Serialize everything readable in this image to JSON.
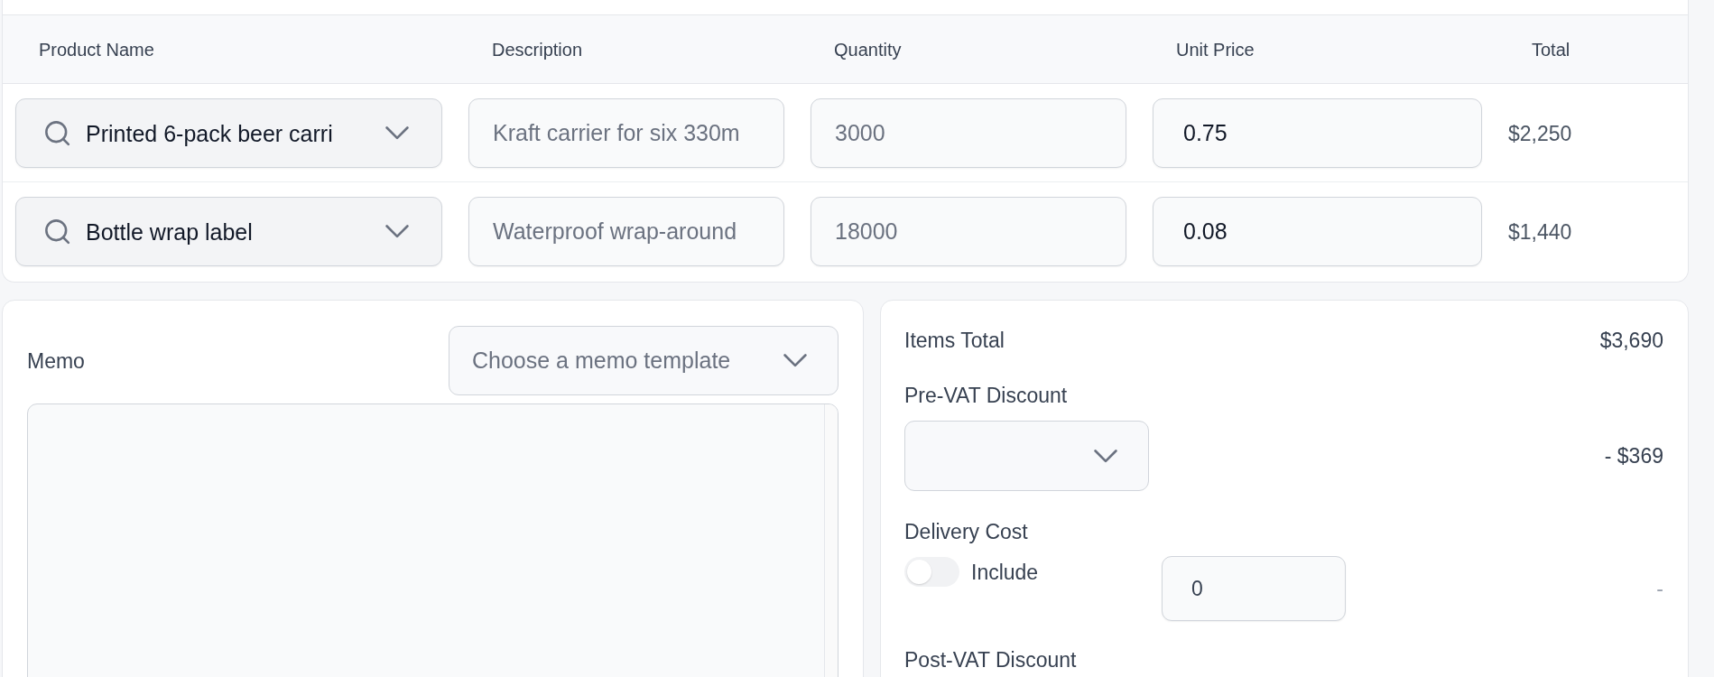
{
  "table": {
    "columns": [
      "Product Name",
      "Description",
      "Quantity",
      "Unit Price",
      "Total"
    ],
    "rows": [
      {
        "product": "Printed 6-pack beer carri",
        "description": {
          "value": "Kraft carrier for six 330m",
          "disabled": true
        },
        "quantity": {
          "value": "3000",
          "disabled": true
        },
        "unit_price": {
          "value": "0.75",
          "disabled": false
        },
        "total": "$2,250"
      },
      {
        "product": "Bottle wrap label",
        "description": {
          "value": "Waterproof wrap-around",
          "disabled": true
        },
        "quantity": {
          "value": "18000",
          "disabled": true
        },
        "unit_price": {
          "value": "0.08",
          "disabled": false
        },
        "total": "$1,440"
      }
    ]
  },
  "memo": {
    "label": "Memo",
    "template_select": {
      "placeholder": "Choose a memo template"
    }
  },
  "summary": {
    "items_total": {
      "label": "Items Total",
      "amount": "$3,690"
    },
    "pre_vat_discount": {
      "label": "Pre-VAT Discount",
      "amount": "- $369"
    },
    "delivery_cost": {
      "label": "Delivery Cost",
      "toggle": {
        "label": "Include",
        "on": false
      },
      "value": "0",
      "amount": "-"
    },
    "post_vat_discount": {
      "label": "Post-VAT Discount"
    }
  }
}
